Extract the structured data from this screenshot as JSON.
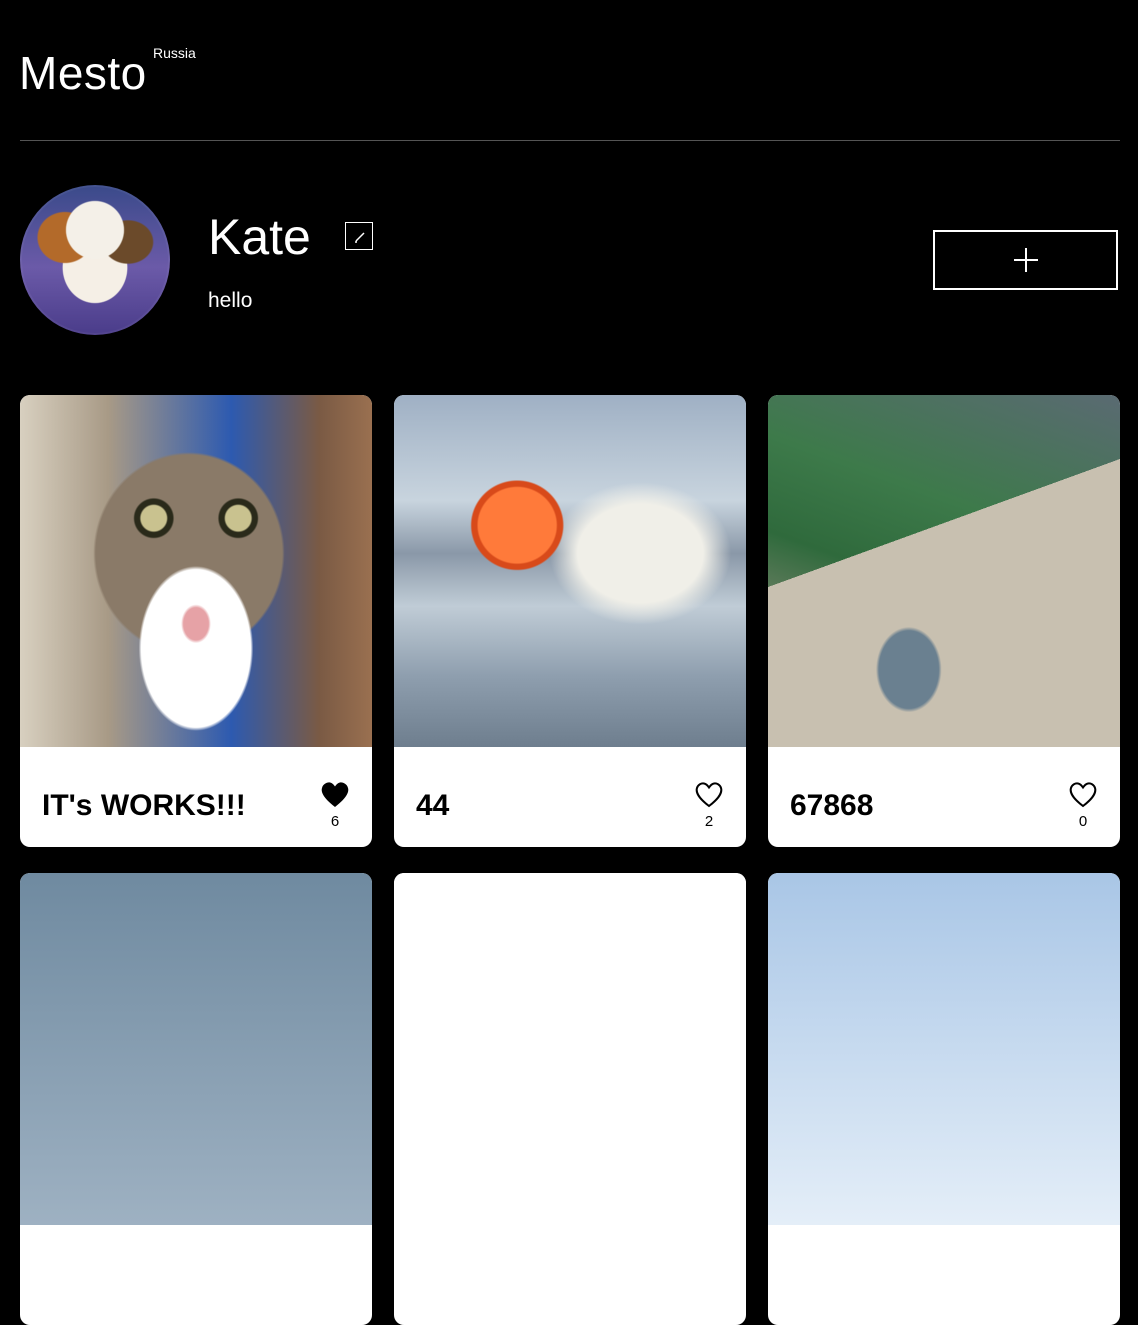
{
  "header": {
    "logo": "Mesto",
    "logo_sup": "Russia"
  },
  "profile": {
    "name": "Kate",
    "about": "hello",
    "avatar_alt": "guinea pig avatar"
  },
  "icons": {
    "edit": "pencil-icon",
    "add": "plus-icon",
    "like_filled": "heart-filled-icon",
    "like_outline": "heart-outline-icon"
  },
  "cards": [
    {
      "title": "IT's WORKS!!!",
      "likes": "6",
      "liked": true,
      "image": "cat photo"
    },
    {
      "title": "44",
      "likes": "2",
      "liked": false,
      "image": "hot air balloon photo"
    },
    {
      "title": "67868",
      "likes": "0",
      "liked": false,
      "image": "mountain landscape photo"
    }
  ],
  "colors": {
    "background": "#000000",
    "card": "#ffffff",
    "text": "#ffffff",
    "divider": "#545454"
  }
}
